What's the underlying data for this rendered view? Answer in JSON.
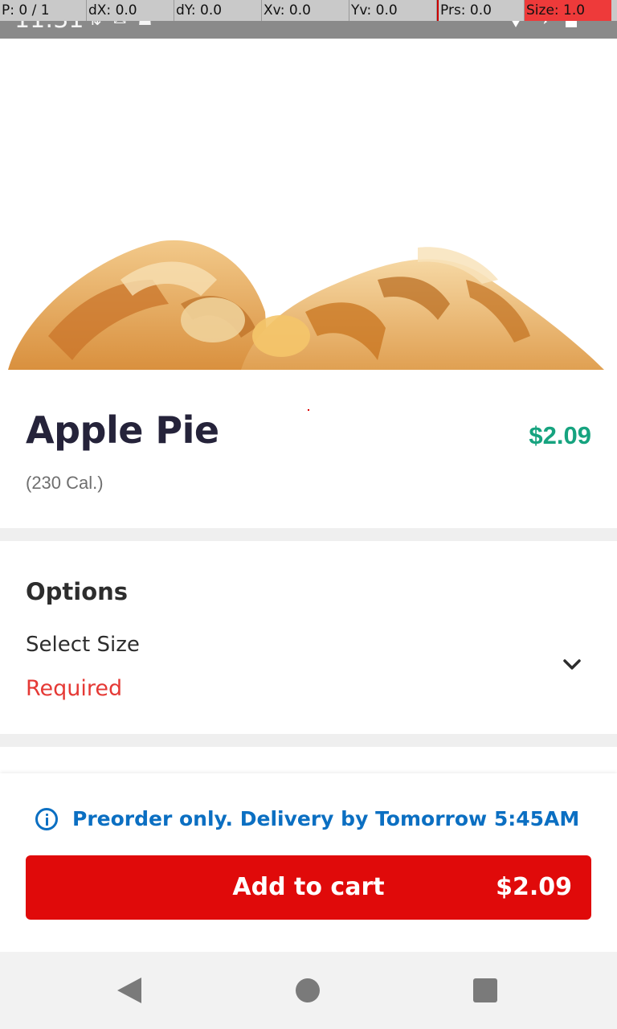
{
  "pointer_overlay": {
    "p": "P: 0 / 1",
    "dx": "dX: 0.0",
    "dy": "dY: 0.0",
    "xv": "Xv: 0.0",
    "yv": "Yv: 0.0",
    "prs": "Prs: 0.0",
    "size": "Size: 1.0"
  },
  "status_bar": {
    "time": "11:31",
    "left_icons": [
      "data-icon",
      "gmail-icon",
      "android-icon"
    ],
    "right_icons": [
      "wifi-icon",
      "airplane-icon",
      "battery-icon"
    ]
  },
  "product": {
    "image": "apple-pie-photo",
    "name": "Apple Pie",
    "price": "$2.09",
    "calories": "(230 Cal.)"
  },
  "options": {
    "title": "Options",
    "items": [
      {
        "label": "Select Size",
        "status": "Required"
      }
    ]
  },
  "notice": {
    "icon": "info-icon",
    "text": "Preorder only. Delivery by Tomorrow 5:45AM"
  },
  "cart_button": {
    "label": "Add to cart",
    "price": "$2.09"
  },
  "nav_bar": {
    "buttons": [
      "back",
      "home",
      "recents"
    ]
  },
  "colors": {
    "price_green": "#16a37f",
    "required_red": "#e53935",
    "notice_blue": "#0b6fc2",
    "cart_red": "#e00a0a",
    "title_dark": "#25233a"
  }
}
